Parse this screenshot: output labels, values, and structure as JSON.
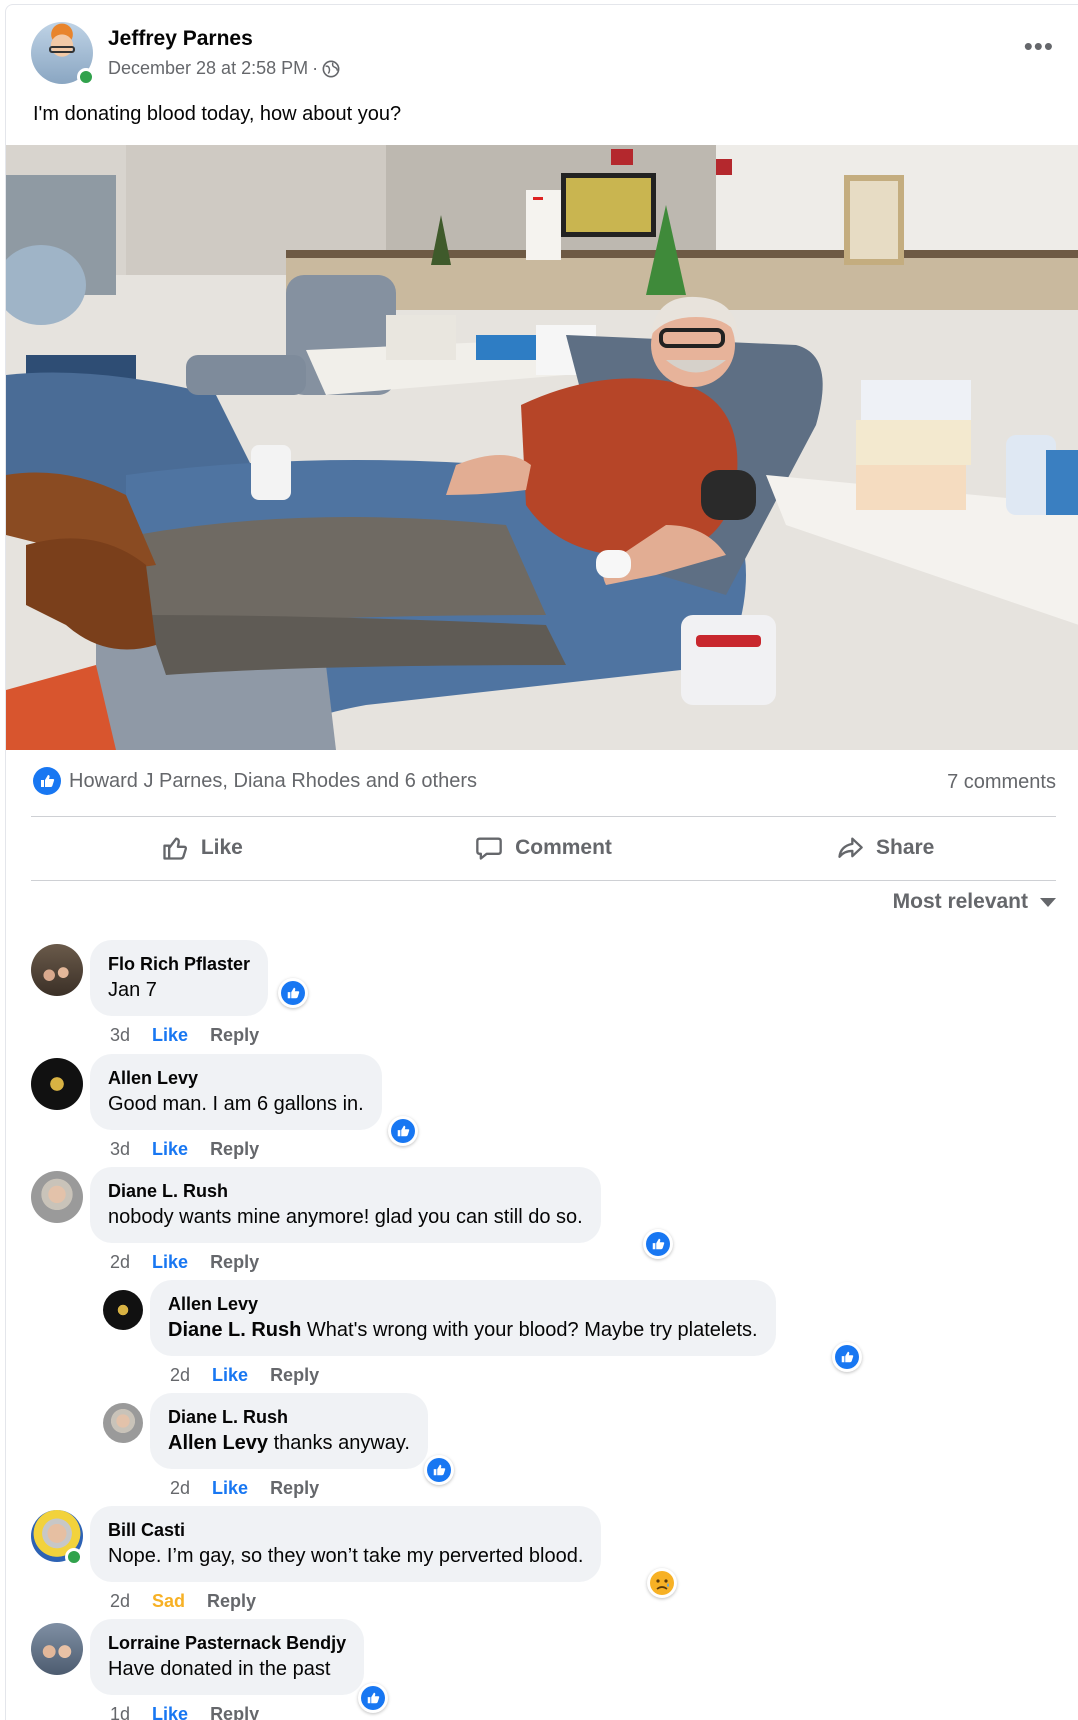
{
  "post": {
    "author": "Jeffrey Parnes",
    "timestamp": "December 28 at 2:58 PM",
    "separator": "·",
    "text": "I'm donating blood today, how about you?",
    "more_label": "•••"
  },
  "reactions": {
    "summary": "Howard J Parnes, Diana Rhodes and 6 others",
    "comment_count": "7 comments"
  },
  "actions": {
    "like": "Like",
    "comment": "Comment",
    "share": "Share"
  },
  "sort_label": "Most relevant",
  "comments": [
    {
      "name": "Flo Rich Pflaster",
      "text": "Jan 7",
      "time": "3d",
      "reaction_label": "Like",
      "reply": "Reply"
    },
    {
      "name": "Allen Levy",
      "text": "Good man. I am 6 gallons in.",
      "time": "3d",
      "reaction_label": "Like",
      "reply": "Reply"
    },
    {
      "name": "Diane L. Rush",
      "text": "nobody wants mine anymore! glad you can still do so.",
      "time": "2d",
      "reaction_label": "Like",
      "reply": "Reply"
    },
    {
      "name": "Allen Levy",
      "mention": "Diane L. Rush",
      "text": " What's wrong with your blood? Maybe try platelets.",
      "time": "2d",
      "reaction_label": "Like",
      "reply": "Reply"
    },
    {
      "name": "Diane L. Rush",
      "mention": "Allen Levy",
      "text": " thanks anyway.",
      "time": "2d",
      "reaction_label": "Like",
      "reply": "Reply"
    },
    {
      "name": "Bill Casti",
      "text": "Nope. I’m gay, so they won’t take my perverted blood.",
      "time": "2d",
      "reaction_label": "Sad",
      "reply": "Reply"
    },
    {
      "name": "Lorraine Pasternack Bendjy",
      "text": "Have donated in the past",
      "time": "1d",
      "reaction_label": "Like",
      "reply": "Reply"
    }
  ],
  "colors": {
    "accent": "#1877f2",
    "secondary_text": "#65676b",
    "bubble": "#f0f2f5",
    "online": "#31a24c",
    "sad": "#f7b125"
  }
}
